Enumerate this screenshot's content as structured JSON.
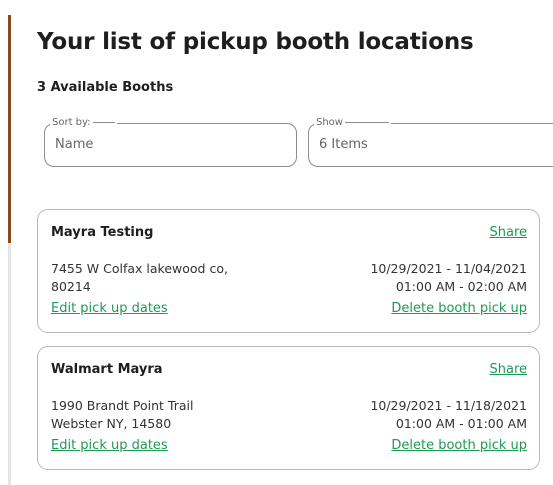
{
  "page": {
    "title": "Your list of pickup booth locations",
    "available_count_text": "3 Available Booths"
  },
  "controls": {
    "sort": {
      "label": "Sort by:",
      "value": "Name"
    },
    "show": {
      "label": "Show",
      "value": "6 Items"
    }
  },
  "booths": [
    {
      "name": "Mayra Testing",
      "share_label": "Share",
      "address_line1": "7455 W Colfax lakewood co,",
      "address_line2": "80214",
      "date_range": "10/29/2021 - 11/04/2021",
      "time_range": "01:00 AM - 02:00 AM",
      "edit_label": "Edit pick up dates",
      "delete_label": "Delete booth pick up"
    },
    {
      "name": "Walmart Mayra",
      "share_label": "Share",
      "address_line1": "1990 Brandt Point Trail",
      "address_line2": "Webster NY, 14580",
      "date_range": "10/29/2021 - 11/18/2021",
      "time_range": "01:00 AM - 01:00 AM",
      "edit_label": "Edit pick up dates",
      "delete_label": "Delete booth pick up"
    }
  ],
  "colors": {
    "accent_bar": "#8a4a1c",
    "link": "#1c9a52",
    "heading_text": "#1e1e1e",
    "field_border": "#8c8c8c",
    "card_border": "#b9b9b9"
  }
}
